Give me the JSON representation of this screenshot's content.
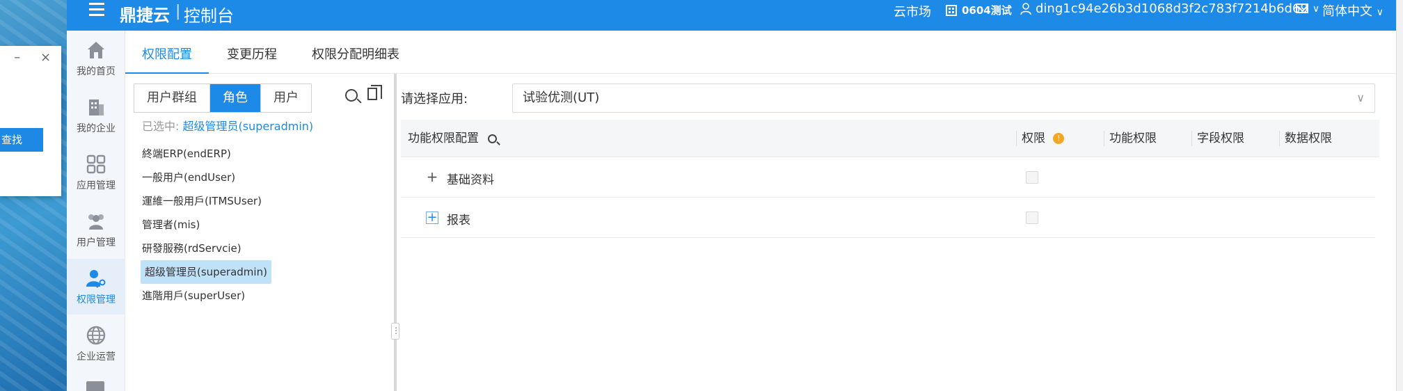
{
  "topbar": {
    "brand": "鼎捷云",
    "separator": "|",
    "console": "控制台",
    "market": "云市场",
    "org": "0604测试",
    "user": "ding1c94e26b3d1068d3f2c783f7214b6d69",
    "language": "简体中文"
  },
  "mini_dialog": {
    "minimize": "–",
    "close": "×",
    "find_button": "查找"
  },
  "leftnav": {
    "items": [
      {
        "label": "我的首页",
        "icon": "home-icon"
      },
      {
        "label": "我的企业",
        "icon": "building-icon"
      },
      {
        "label": "应用管理",
        "icon": "grid-icon"
      },
      {
        "label": "用户管理",
        "icon": "users-icon"
      },
      {
        "label": "权限管理",
        "icon": "user-key-icon",
        "active": true
      },
      {
        "label": "企业运营",
        "icon": "globe-icon"
      }
    ]
  },
  "tabs": [
    "权限配置",
    "变更历程",
    "权限分配明细表"
  ],
  "role_panel": {
    "segments": [
      "用户群组",
      "角色",
      "用户"
    ],
    "active_segment": "角色",
    "selected_prefix": "已选中:",
    "selected_value": "超级管理员(superadmin)",
    "roles": [
      "終端ERP(endERP)",
      "一般用户(endUser)",
      "運維一般用戶(ITMSUser)",
      "管理者(mis)",
      "研發服務(rdServcie)",
      "超级管理员(superadmin)",
      "進階用戶(superUser)"
    ],
    "active_role": "超级管理员(superadmin)"
  },
  "config": {
    "app_label": "请选择应用:",
    "app_value": "试验优测(UT)",
    "columns": {
      "func_config": "功能权限配置",
      "permission": "权限",
      "func_perm": "功能权限",
      "field_perm": "字段权限",
      "data_perm": "数据权限"
    },
    "rows": [
      {
        "expander": "+",
        "label": "基础资料"
      },
      {
        "expander": "+",
        "label": "报表"
      }
    ]
  },
  "colors": {
    "primary": "#1d8ae8",
    "nav_bg": "#f3f6fa",
    "selected_role_bg": "#bfe2f8",
    "warning": "#f5a623"
  }
}
